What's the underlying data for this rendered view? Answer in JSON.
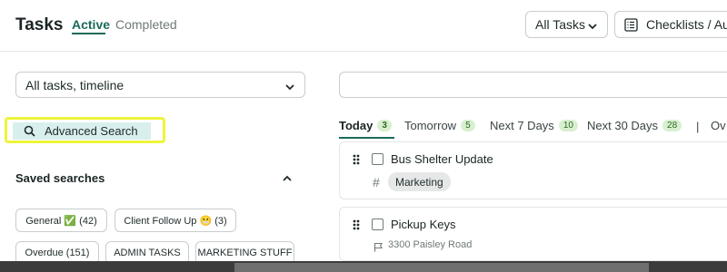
{
  "header": {
    "title": "Tasks",
    "tabs": [
      {
        "label": "Active"
      },
      {
        "label": "Completed"
      }
    ],
    "all_tasks_label": "All Tasks",
    "checklists_label": "Checklists / Aut"
  },
  "filters": {
    "timeline_select": "All tasks, timeline",
    "search_value": ""
  },
  "advanced_search": {
    "label": "Advanced Search"
  },
  "saved_searches": {
    "title": "Saved searches",
    "chips": [
      {
        "label": "General ✅ (42)"
      },
      {
        "label": "Client Follow Up 😬 (3)"
      },
      {
        "label": "Overdue (151)"
      },
      {
        "label": "ADMIN TASKS"
      },
      {
        "label": "MARKETING STUFF"
      }
    ]
  },
  "timeline_tabs": [
    {
      "label": "Today",
      "count": "3"
    },
    {
      "label": "Tomorrow",
      "count": "5"
    },
    {
      "label": "Next 7 Days",
      "count": "10"
    },
    {
      "label": "Next 30 Days",
      "count": "28"
    },
    {
      "label": "Ov"
    }
  ],
  "timeline_separator": "|",
  "tasks": [
    {
      "title": "Bus Shelter Update",
      "tag": "Marketing",
      "hash": "#"
    },
    {
      "title": "Pickup Keys",
      "location": "3300 Paisley Road"
    }
  ],
  "colors": {
    "accent": "#1a6b5a",
    "highlight": "#eef53a",
    "count_badge": "#d8f0cf"
  }
}
